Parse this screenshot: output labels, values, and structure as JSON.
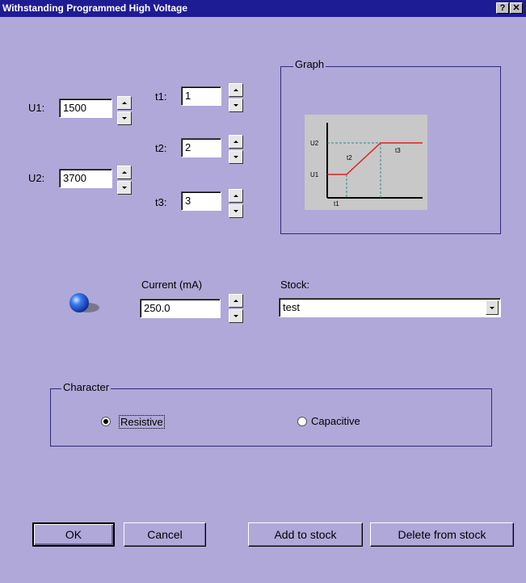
{
  "window": {
    "title": "Withstanding Programmed High Voltage",
    "help_label": "?",
    "close_label": "✕"
  },
  "voltage": {
    "u1_label": "U1:",
    "u1_value": "1500",
    "u2_label": "U2:",
    "u2_value": "3700"
  },
  "times": {
    "t1_label": "t1:",
    "t1_value": "1",
    "t2_label": "t2:",
    "t2_value": "2",
    "t3_label": "t3:",
    "t3_value": "3"
  },
  "graph": {
    "group_title": "Graph",
    "u2_tick": "U2",
    "u1_tick": "U1",
    "t1_tick": "t1",
    "t2_label": "t2",
    "t3_label": "t3"
  },
  "current": {
    "label": "Current (mA)",
    "value": "250.0"
  },
  "stock": {
    "label": "Stock:",
    "value": "test"
  },
  "character": {
    "group_title": "Character",
    "resistive_label": "Resistive",
    "capacitive_label": "Capacitive",
    "selected": "Resistive"
  },
  "buttons": {
    "ok": "OK",
    "cancel": "Cancel",
    "add_to_stock": "Add to stock",
    "delete_from_stock": "Delete from stock"
  }
}
